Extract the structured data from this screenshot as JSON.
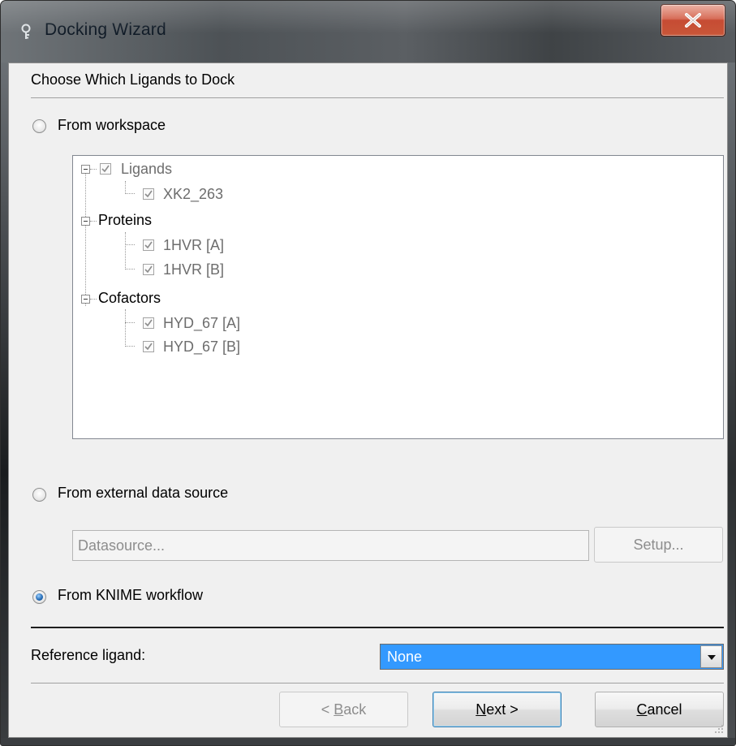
{
  "window": {
    "title": "Docking Wizard",
    "close_symbol": "X"
  },
  "page": {
    "heading": "Choose Which Ligands to Dock"
  },
  "sources": {
    "workspace_label": "From workspace",
    "external_label": "From external data source",
    "knime_label": "From KNIME workflow",
    "selected": "knime"
  },
  "tree": {
    "ligands_group": "Ligands",
    "ligand_1": "XK2_263",
    "proteins_group": "Proteins",
    "protein_1": "1HVR [A]",
    "protein_2": "1HVR [B]",
    "cofactors_group": "Cofactors",
    "cofactor_1": "HYD_67 [A]",
    "cofactor_2": "HYD_67 [B]"
  },
  "datasource": {
    "placeholder": "Datasource...",
    "setup_label": "Setup..."
  },
  "reference": {
    "label": "Reference ligand:",
    "selected_value": "None"
  },
  "buttons": {
    "back_prefix": "< ",
    "back_mnemonic": "B",
    "back_rest": "ack",
    "next_mnemonic": "N",
    "next_rest": "ext >",
    "cancel_mnemonic": "C",
    "cancel_rest": "ancel"
  },
  "icons": {
    "app": "key-icon",
    "close": "close-icon",
    "dropdown": "chevron-down-icon",
    "check": "check-icon",
    "resize": "resize-grip-icon"
  },
  "colors": {
    "selection": "#3399ff",
    "close_button": "#c94a30",
    "radio_dot": "#2a6fb8"
  }
}
